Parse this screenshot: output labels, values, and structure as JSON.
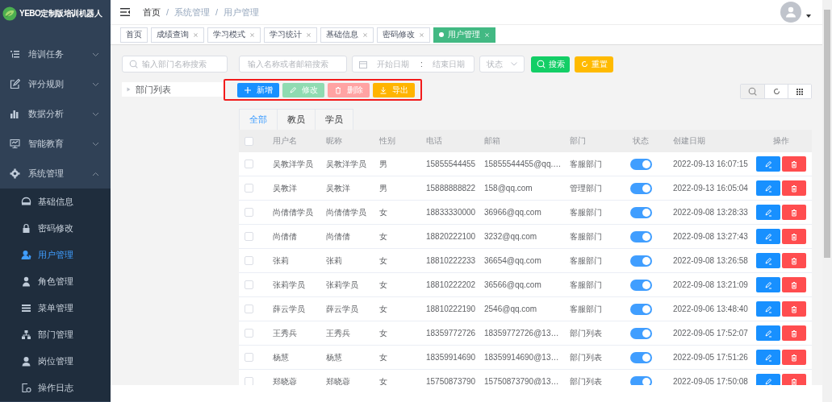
{
  "logo": {
    "text": "YEBO定制版培训机器人"
  },
  "sidebar": {
    "items": [
      {
        "label": "培训任务",
        "expanded": false
      },
      {
        "label": "评分规则",
        "expanded": false
      },
      {
        "label": "数据分析",
        "expanded": false
      },
      {
        "label": "智能教育",
        "expanded": false
      },
      {
        "label": "系统管理",
        "expanded": true,
        "children": [
          {
            "label": "基础信息",
            "selected": false
          },
          {
            "label": "密码修改",
            "selected": false
          },
          {
            "label": "用户管理",
            "selected": true
          },
          {
            "label": "角色管理",
            "selected": false
          },
          {
            "label": "菜单管理",
            "selected": false
          },
          {
            "label": "部门管理",
            "selected": false
          },
          {
            "label": "岗位管理",
            "selected": false
          },
          {
            "label": "操作日志",
            "selected": false
          }
        ]
      }
    ]
  },
  "breadcrumb": [
    "首页",
    "系统管理",
    "用户管理"
  ],
  "breadcrumb_separator": "/",
  "tags": [
    {
      "label": "首页",
      "closable": false,
      "selected": false
    },
    {
      "label": "成绩查询",
      "closable": true,
      "selected": false
    },
    {
      "label": "学习模式",
      "closable": true,
      "selected": false
    },
    {
      "label": "学习统计",
      "closable": true,
      "selected": false
    },
    {
      "label": "基础信息",
      "closable": true,
      "selected": false
    },
    {
      "label": "密码修改",
      "closable": true,
      "selected": false
    },
    {
      "label": "用户管理",
      "closable": true,
      "selected": true
    }
  ],
  "filters": {
    "dept_search": {
      "placeholder": "输入部门名称搜索"
    },
    "name_search": {
      "placeholder": "输入名称或者邮箱搜索"
    },
    "date_range": {
      "start_placeholder": "开始日期",
      "separator": ":",
      "end_placeholder": "结束日期"
    },
    "status": {
      "placeholder": "状态"
    },
    "search_button": "搜索",
    "reset_button": "重置"
  },
  "dept_tree": {
    "label": "部门列表",
    "expanded": false
  },
  "actions": [
    {
      "label": "新增",
      "kind": "add",
      "disabled": false
    },
    {
      "label": "修改",
      "kind": "edit",
      "disabled": true
    },
    {
      "label": "删除",
      "kind": "delete",
      "disabled": true
    },
    {
      "label": "导出",
      "kind": "export",
      "disabled": false
    }
  ],
  "tabs": [
    {
      "label": "全部",
      "selected": true
    },
    {
      "label": "教员",
      "selected": false
    },
    {
      "label": "学员",
      "selected": false
    }
  ],
  "table": {
    "select_all": false,
    "columns": [
      "用户名",
      "昵称",
      "性别",
      "电话",
      "邮箱",
      "部门",
      "状态",
      "创建日期",
      "操作"
    ],
    "rows": [
      {
        "checked": false,
        "username": "吴教洋学员",
        "nickname": "吴教洋学员",
        "gender": "男",
        "phone": "15855544455",
        "email": "15855544455@qq.…",
        "dept": "客服部门",
        "enabled": true,
        "created": "2022-09-13 16:07:15"
      },
      {
        "checked": false,
        "username": "吴教洋",
        "nickname": "吴教洋",
        "gender": "男",
        "phone": "15888888822",
        "email": "158@qq.com",
        "dept": "管理部门",
        "enabled": true,
        "created": "2022-09-13 16:05:04"
      },
      {
        "checked": false,
        "username": "尚倩倩学员",
        "nickname": "尚倩倩学员",
        "gender": "女",
        "phone": "18833330000",
        "email": "36966@qq.com",
        "dept": "客服部门",
        "enabled": true,
        "created": "2022-09-08 13:28:33"
      },
      {
        "checked": false,
        "username": "尚倩倩",
        "nickname": "尚倩倩",
        "gender": "女",
        "phone": "18820222100",
        "email": "3232@qq.com",
        "dept": "客服部门",
        "enabled": true,
        "created": "2022-09-08 13:27:43"
      },
      {
        "checked": false,
        "username": "张莉",
        "nickname": "张莉",
        "gender": "女",
        "phone": "18810222233",
        "email": "36654@qq.com",
        "dept": "客服部门",
        "enabled": true,
        "created": "2022-09-08 13:26:58"
      },
      {
        "checked": false,
        "username": "张莉学员",
        "nickname": "张莉学员",
        "gender": "女",
        "phone": "18810222202",
        "email": "36566@qq.com",
        "dept": "客服部门",
        "enabled": true,
        "created": "2022-09-08 13:21:09"
      },
      {
        "checked": false,
        "username": "薛云学员",
        "nickname": "薛云学员",
        "gender": "女",
        "phone": "18810222190",
        "email": "2546@qq.com",
        "dept": "客服部门",
        "enabled": true,
        "created": "2022-09-06 13:48:40"
      },
      {
        "checked": false,
        "username": "王秀兵",
        "nickname": "王秀兵",
        "gender": "女",
        "phone": "18359772726",
        "email": "18359772726@13…",
        "dept": "部门列表",
        "enabled": true,
        "created": "2022-09-05 17:52:07"
      },
      {
        "checked": false,
        "username": "杨慧",
        "nickname": "杨慧",
        "gender": "女",
        "phone": "18359914690",
        "email": "18359914690@13…",
        "dept": "部门列表",
        "enabled": true,
        "created": "2022-09-05 17:51:26"
      },
      {
        "checked": false,
        "username": "郑晓蓉",
        "nickname": "郑晓蓉",
        "gender": "女",
        "phone": "15750873790",
        "email": "15750873790@13…",
        "dept": "部门列表",
        "enabled": true,
        "created": "2022-09-05 17:50:08"
      }
    ]
  }
}
